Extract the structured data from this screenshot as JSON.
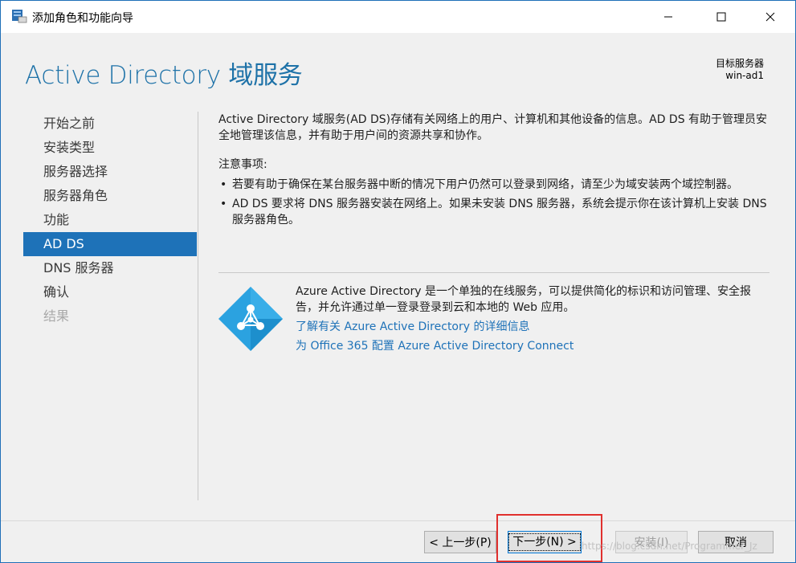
{
  "window": {
    "title": "添加角色和功能向导",
    "controls": {
      "minimize": "minimize-icon",
      "maximize": "maximize-icon",
      "close": "close-icon"
    }
  },
  "header": {
    "title": "Active Directory 域服务",
    "target_label": "目标服务器",
    "target_value": "win-ad1"
  },
  "nav": {
    "items": [
      {
        "label": "开始之前",
        "state": "normal"
      },
      {
        "label": "安装类型",
        "state": "normal"
      },
      {
        "label": "服务器选择",
        "state": "normal"
      },
      {
        "label": "服务器角色",
        "state": "normal"
      },
      {
        "label": "功能",
        "state": "normal"
      },
      {
        "label": "AD DS",
        "state": "active"
      },
      {
        "label": "DNS 服务器",
        "state": "normal"
      },
      {
        "label": "确认",
        "state": "normal"
      },
      {
        "label": "结果",
        "state": "disabled"
      }
    ]
  },
  "main": {
    "intro": "Active Directory 域服务(AD DS)存储有关网络上的用户、计算机和其他设备的信息。AD DS 有助于管理员安全地管理该信息，并有助于用户间的资源共享和协作。",
    "notes_title": "注意事项:",
    "bullets": [
      "若要有助于确保在某台服务器中断的情况下用户仍然可以登录到网络，请至少为域安装两个域控制器。",
      "AD DS 要求将 DNS 服务器安装在网络上。如果未安装 DNS 服务器，系统会提示你在该计算机上安装 DNS 服务器角色。"
    ],
    "azure": {
      "description": "Azure Active Directory 是一个单独的在线服务，可以提供简化的标识和访问管理、安全报告，并允许通过单一登录登录到云和本地的 Web 应用。",
      "link1": "了解有关 Azure Active Directory 的详细信息",
      "link2": "为 Office 365 配置 Azure Active Directory Connect"
    }
  },
  "footer": {
    "prev": "< 上一步(P)",
    "next": "下一步(N) >",
    "install": "安装(I)",
    "cancel": "取消"
  },
  "watermark": "https://blog.csdn.net/Programmer_Jz",
  "colors": {
    "accent": "#1e72b8",
    "highlight": "#e0302e"
  }
}
